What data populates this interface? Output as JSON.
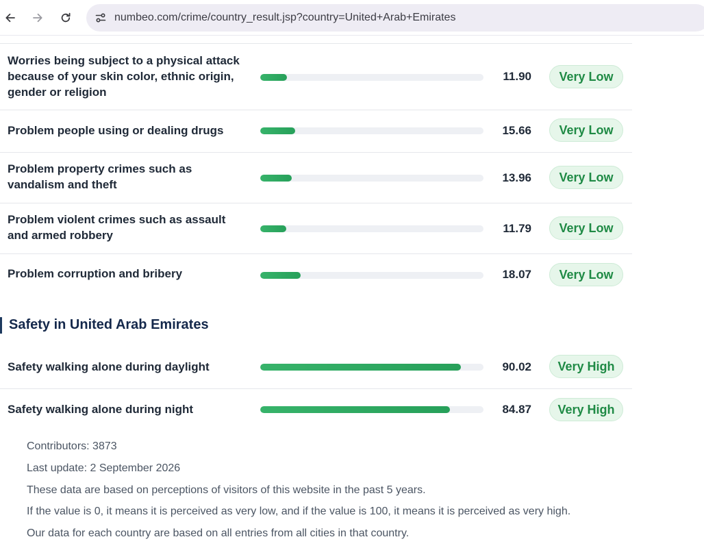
{
  "browser": {
    "url": "numbeo.com/crime/country_result.jsp?country=United+Arab+Emirates"
  },
  "crime_rows": [
    {
      "label": "Worries being subject to a physical attack because of your skin color, ethnic origin, gender or religion",
      "value": "11.90",
      "level": 11.9,
      "badge": "Very Low"
    },
    {
      "label": "Problem people using or dealing drugs",
      "value": "15.66",
      "level": 15.66,
      "badge": "Very Low"
    },
    {
      "label": "Problem property crimes such as vandalism and theft",
      "value": "13.96",
      "level": 13.96,
      "badge": "Very Low"
    },
    {
      "label": "Problem violent crimes such as assault and armed robbery",
      "value": "11.79",
      "level": 11.79,
      "badge": "Very Low"
    },
    {
      "label": "Problem corruption and bribery",
      "value": "18.07",
      "level": 18.07,
      "badge": "Very Low"
    }
  ],
  "safety": {
    "heading": "Safety in United Arab Emirates",
    "rows": [
      {
        "label": "Safety walking alone during daylight",
        "value": "90.02",
        "level": 90.02,
        "badge": "Very High"
      },
      {
        "label": "Safety walking alone during night",
        "value": "84.87",
        "level": 84.87,
        "badge": "Very High"
      }
    ]
  },
  "footer": {
    "contributors": "Contributors: 3873",
    "last_update": "Last update: 2 September 2026",
    "note_1": "These data are based on perceptions of visitors of this website in the past 5 years.",
    "note_2": "If the value is 0, it means it is perceived as very low, and if the value is 100, it means it is perceived as very high.",
    "note_3": "Our data for each country are based on all entries from all cities in that country."
  },
  "colors": {
    "bar_fill": "#2fa862",
    "bar_track": "#eef0f4",
    "badge_bg": "#e6f6ea",
    "badge_text": "#1f8a45",
    "heading": "#14284b"
  }
}
